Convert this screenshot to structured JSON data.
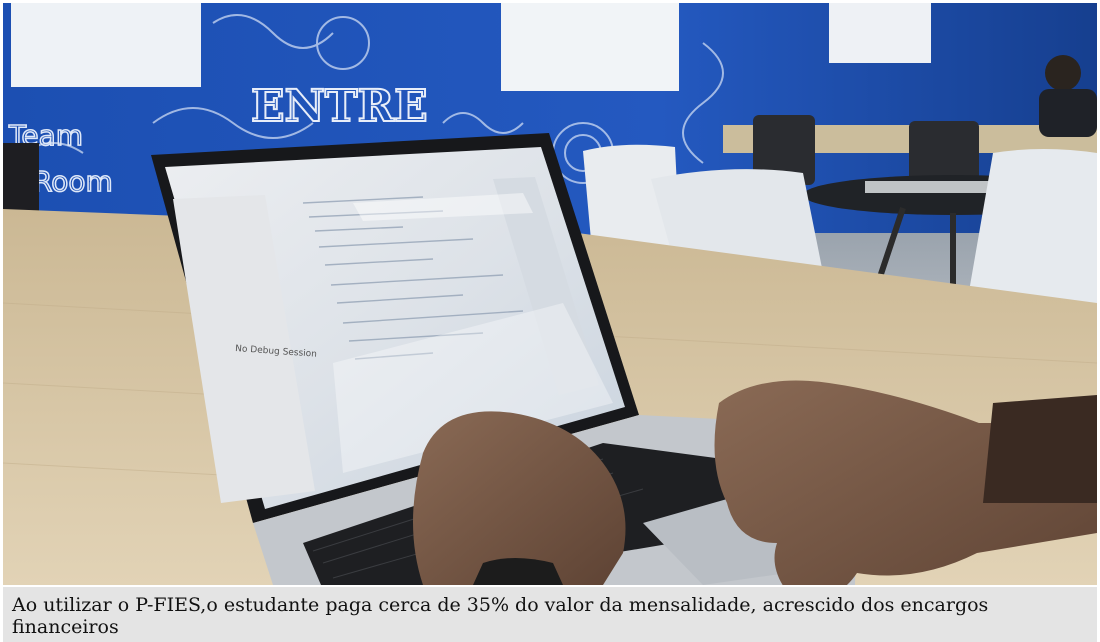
{
  "photo": {
    "description_icon": "photo-image",
    "wall_text": "ENTRE",
    "wall_text_left": "Team",
    "wall_text_left2": "Room",
    "screen_label": "No Debug Session",
    "colors": {
      "wall": "#1f56b8",
      "desk": "#d9c7a6",
      "chair": "#e6eaee",
      "laptop": "#c8ccd1",
      "keyboard": "#1e1f22",
      "skin": "#7a5a48"
    }
  },
  "caption": {
    "text": "Ao utilizar o P-FIES,o estudante paga cerca de 35% do valor da mensalidade, acrescido dos encargos financeiros"
  }
}
